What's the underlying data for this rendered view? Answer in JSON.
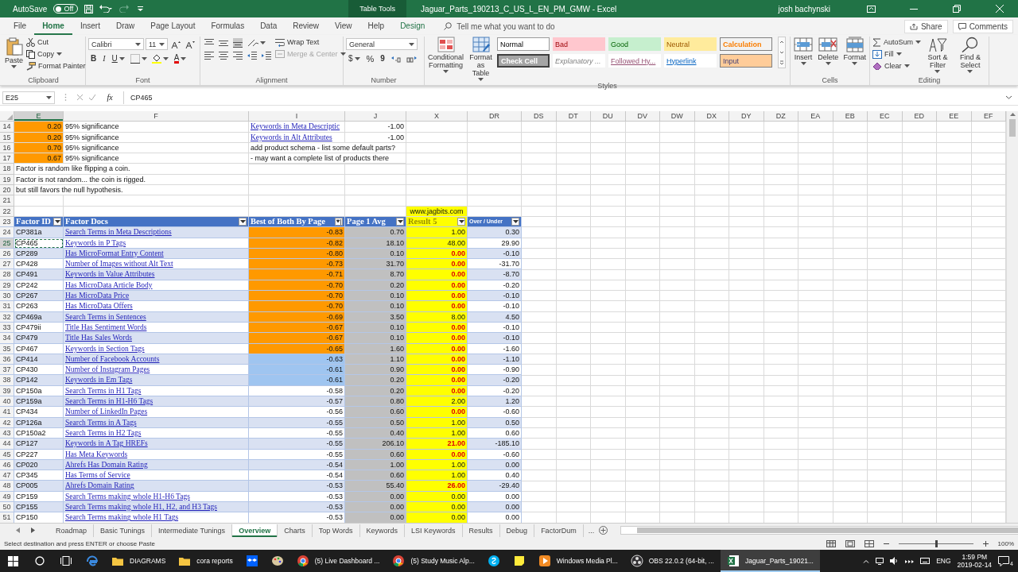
{
  "title_bar": {
    "autosave_label": "AutoSave",
    "autosave": {
      "label": "Off",
      "on": false
    },
    "context_tab": "Table Tools",
    "title": "Jaguar_Parts_190213_C_US_L_EN_PM_GMW  -  Excel",
    "user": "josh bachynski"
  },
  "menu": {
    "tabs": [
      {
        "label": "File",
        "kind": "standard",
        "selected": false
      },
      {
        "label": "Home",
        "kind": "standard",
        "selected": true
      },
      {
        "label": "Insert",
        "kind": "standard",
        "selected": false
      },
      {
        "label": "Draw",
        "kind": "standard",
        "selected": false
      },
      {
        "label": "Page Layout",
        "kind": "standard",
        "selected": false
      },
      {
        "label": "Formulas",
        "kind": "standard",
        "selected": false
      },
      {
        "label": "Data",
        "kind": "standard",
        "selected": false
      },
      {
        "label": "Review",
        "kind": "standard",
        "selected": false
      },
      {
        "label": "View",
        "kind": "standard",
        "selected": false
      },
      {
        "label": "Help",
        "kind": "standard",
        "selected": false
      },
      {
        "label": "Design",
        "kind": "contextual",
        "selected": false
      }
    ],
    "search_placeholder": "Tell me what you want to do",
    "share": "Share",
    "comments": "Comments"
  },
  "ribbon": [
    {
      "name": "Clipboard",
      "columns": [
        [
          [
            {
              "kind": "paste",
              "label": "Paste"
            }
          ]
        ],
        [
          [
            {
              "kind": "cut",
              "label": "Cut"
            }
          ],
          [
            {
              "kind": "copy",
              "label": "Copy"
            }
          ],
          [
            {
              "kind": "painter",
              "label": "Format Painter"
            }
          ]
        ]
      ]
    },
    {
      "name": "Font",
      "columns": [
        [
          [
            {
              "kind": "fontname",
              "label": "Calibri"
            },
            {
              "kind": "fontsize",
              "label": "11"
            },
            {
              "kind": "grow"
            },
            {
              "kind": "shrink"
            }
          ],
          [
            {
              "kind": "bold",
              "label": "B"
            },
            {
              "kind": "italic",
              "label": "I"
            },
            {
              "kind": "underline",
              "label": "U"
            },
            {
              "kind": "borders"
            },
            {
              "kind": "fillcolor"
            },
            {
              "kind": "fontcolor",
              "label": "A"
            }
          ]
        ]
      ]
    },
    {
      "name": "Alignment",
      "columns": [
        [
          [
            {
              "kind": "aligntop"
            },
            {
              "kind": "alignmiddle"
            },
            {
              "kind": "alignbottom"
            },
            {
              "kind": "orient"
            }
          ],
          [
            {
              "kind": "alignleft"
            },
            {
              "kind": "aligncenter"
            },
            {
              "kind": "alignright"
            },
            {
              "kind": "indentdec"
            },
            {
              "kind": "indentinc"
            }
          ]
        ],
        [
          [
            {
              "kind": "wrap",
              "label": "Wrap Text",
              "disabled": false
            }
          ],
          [
            {
              "kind": "merge",
              "label": "Merge & Center",
              "disabled": true
            }
          ]
        ]
      ]
    },
    {
      "name": "Number",
      "columns": [
        [
          [
            {
              "kind": "numformat",
              "label": "General"
            }
          ],
          [
            {
              "kind": "currency",
              "label": "$"
            },
            {
              "kind": "percent",
              "label": "%"
            },
            {
              "kind": "comma",
              "label": "9"
            },
            {
              "kind": "incdec"
            },
            {
              "kind": "decdec"
            }
          ]
        ]
      ]
    },
    {
      "name": "Styles",
      "columns": [
        [
          [
            {
              "kind": "cond",
              "label": "Conditional Formatting"
            }
          ]
        ],
        [
          [
            {
              "kind": "table",
              "label": "Format as Table"
            }
          ]
        ],
        [
          [
            {
              "kind": "normal",
              "label": "Normal"
            },
            {
              "kind": "bad",
              "label": "Bad"
            },
            {
              "kind": "good",
              "label": "Good"
            },
            {
              "kind": "neutral",
              "label": "Neutral"
            },
            {
              "kind": "calculation",
              "label": "Calculation"
            }
          ],
          [
            {
              "kind": "check",
              "label": "Check Cell"
            },
            {
              "kind": "explanatory",
              "label": "Explanatory ..."
            },
            {
              "kind": "followed",
              "label": "Followed Hy..."
            },
            {
              "kind": "hyperlink",
              "label": "Hyperlink"
            },
            {
              "kind": "input",
              "label": "Input"
            }
          ]
        ],
        [
          [
            {
              "kind": "more"
            }
          ]
        ]
      ]
    },
    {
      "name": "Cells",
      "columns": [
        [
          [
            {
              "kind": "insert",
              "label": "Insert"
            }
          ]
        ],
        [
          [
            {
              "kind": "delete",
              "label": "Delete"
            }
          ]
        ],
        [
          [
            {
              "kind": "format",
              "label": "Format"
            }
          ]
        ]
      ]
    },
    {
      "name": "Editing",
      "columns": [
        [
          [
            {
              "kind": "autosum",
              "label": "AutoSum"
            }
          ],
          [
            {
              "kind": "fill",
              "label": "Fill"
            }
          ],
          [
            {
              "kind": "clear",
              "label": "Clear"
            }
          ]
        ],
        [
          [
            {
              "kind": "sort",
              "label": "Sort & Filter"
            }
          ]
        ],
        [
          [
            {
              "kind": "find",
              "label": "Find & Select"
            }
          ]
        ]
      ]
    }
  ],
  "formula_bar": {
    "name_box": "E25",
    "function_label": "fx",
    "formula": "CP465"
  },
  "columns": [
    {
      "label": "E",
      "selected": true
    },
    {
      "label": "F",
      "selected": false
    },
    {
      "label": "I",
      "selected": false
    },
    {
      "label": "J",
      "selected": false
    },
    {
      "label": "X",
      "selected": false
    },
    {
      "label": "DR",
      "selected": false
    },
    {
      "label": "DS",
      "selected": false
    },
    {
      "label": "DT",
      "selected": false
    },
    {
      "label": "DU",
      "selected": false
    },
    {
      "label": "DV",
      "selected": false
    },
    {
      "label": "DW",
      "selected": false
    },
    {
      "label": "DX",
      "selected": false
    },
    {
      "label": "DY",
      "selected": false
    },
    {
      "label": "DZ",
      "selected": false
    },
    {
      "label": "EA",
      "selected": false
    },
    {
      "label": "EB",
      "selected": false
    },
    {
      "label": "EC",
      "selected": false
    },
    {
      "label": "ED",
      "selected": false
    },
    {
      "label": "EE",
      "selected": false
    },
    {
      "label": "EF",
      "selected": false
    }
  ],
  "notes_rows": [
    {
      "num": "14",
      "selected": false,
      "e": {
        "kind": "highlight",
        "text": "0.20"
      },
      "f": {
        "kind": "text",
        "text": "95% significance"
      },
      "i": {
        "kind": "link",
        "text": "Keywords in Meta Descriptic"
      },
      "j": {
        "kind": "number",
        "text": "-1.00"
      }
    },
    {
      "num": "15",
      "selected": false,
      "e": {
        "kind": "highlight",
        "text": "0.20"
      },
      "f": {
        "kind": "text",
        "text": "95% significance"
      },
      "i": {
        "kind": "link",
        "text": "Keywords in Alt Attributes"
      },
      "j": {
        "kind": "number",
        "text": "-1.00"
      }
    },
    {
      "num": "16",
      "selected": false,
      "e": {
        "kind": "highlight",
        "text": "0.70"
      },
      "f": {
        "kind": "text",
        "text": "95% significance"
      },
      "i": {
        "kind": "text",
        "text": "add product schema - list some default parts?"
      }
    },
    {
      "num": "17",
      "selected": false,
      "e": {
        "kind": "highlight",
        "text": "0.67"
      },
      "f": {
        "kind": "text",
        "text": "95% significance"
      },
      "i": {
        "kind": "text",
        "text": "- may want a complete list of products there"
      }
    },
    {
      "num": "18",
      "selected": false,
      "e": {
        "kind": "text",
        "text": "Factor is random like flipping a coin."
      }
    },
    {
      "num": "19",
      "selected": false,
      "e": {
        "kind": "text",
        "text": "Factor is not random... the coin is rigged."
      }
    },
    {
      "num": "20",
      "selected": false,
      "e": {
        "kind": "text",
        "text": "but still favors the null hypothesis."
      }
    },
    {
      "num": "21",
      "selected": false
    },
    {
      "num": "22",
      "selected": false,
      "x": {
        "kind": "banner",
        "text": "www.jagbits.com"
      }
    }
  ],
  "table": {
    "header_num": "23",
    "header_selected": false,
    "columns": [
      {
        "label": "Factor ID",
        "sorted": false
      },
      {
        "label": "Factor Docs",
        "sorted": false
      },
      {
        "label": "Best of Both By Page",
        "sorted": true
      },
      {
        "label": "Page 1 Avg",
        "sorted": false
      },
      {
        "label": "Result 5",
        "sorted": false
      },
      {
        "label": "Over / Under",
        "sorted": false
      }
    ],
    "rows": [
      {
        "num": "24",
        "id": "CP381a",
        "doc": "Search Terms in Meta Descriptions",
        "best": "-0.83",
        "avg": "0.70",
        "result": "1.00",
        "over_under": "0.30",
        "color": "#ff9900",
        "flagged": false,
        "selected": false
      },
      {
        "num": "25",
        "id": "CP465",
        "doc": "Keywords in P Tags",
        "best": "-0.82",
        "avg": "18.10",
        "result": "48.00",
        "over_under": "29.90",
        "color": "#ff9900",
        "flagged": false,
        "selected": true
      },
      {
        "num": "26",
        "id": "CP289",
        "doc": "Has MicroFormat Entry Content",
        "best": "-0.80",
        "avg": "0.10",
        "result": "0.00",
        "over_under": "-0.10",
        "color": "#ff9900",
        "flagged": true,
        "selected": false
      },
      {
        "num": "27",
        "id": "CP428",
        "doc": "Number of Images without Alt Text",
        "best": "-0.73",
        "avg": "31.70",
        "result": "0.00",
        "over_under": "-31.70",
        "color": "#ff9900",
        "flagged": true,
        "selected": false
      },
      {
        "num": "28",
        "id": "CP491",
        "doc": "Keywords in Value Attributes",
        "best": "-0.71",
        "avg": "8.70",
        "result": "0.00",
        "over_under": "-8.70",
        "color": "#ff9900",
        "flagged": true,
        "selected": false
      },
      {
        "num": "29",
        "id": "CP242",
        "doc": "Has MicroData Article Body",
        "best": "-0.70",
        "avg": "0.20",
        "result": "0.00",
        "over_under": "-0.20",
        "color": "#ff9900",
        "flagged": true,
        "selected": false
      },
      {
        "num": "30",
        "id": "CP267",
        "doc": "Has MicroData Price",
        "best": "-0.70",
        "avg": "0.10",
        "result": "0.00",
        "over_under": "-0.10",
        "color": "#ff9900",
        "flagged": true,
        "selected": false
      },
      {
        "num": "31",
        "id": "CP263",
        "doc": "Has MicroData Offers",
        "best": "-0.70",
        "avg": "0.10",
        "result": "0.00",
        "over_under": "-0.10",
        "color": "#ff9900",
        "flagged": true,
        "selected": false
      },
      {
        "num": "32",
        "id": "CP469a",
        "doc": "Search Terms in Sentences",
        "best": "-0.69",
        "avg": "3.50",
        "result": "8.00",
        "over_under": "4.50",
        "color": "#ff9900",
        "flagged": false,
        "selected": false
      },
      {
        "num": "33",
        "id": "CP479ii",
        "doc": "Title Has Sentiment Words",
        "best": "-0.67",
        "avg": "0.10",
        "result": "0.00",
        "over_under": "-0.10",
        "color": "#ff9900",
        "flagged": true,
        "selected": false
      },
      {
        "num": "34",
        "id": "CP479",
        "doc": "Title Has Sales Words",
        "best": "-0.67",
        "avg": "0.10",
        "result": "0.00",
        "over_under": "-0.10",
        "color": "#ff9900",
        "flagged": true,
        "selected": false
      },
      {
        "num": "35",
        "id": "CP467",
        "doc": "Keywords in Section Tags",
        "best": "-0.65",
        "avg": "1.60",
        "result": "0.00",
        "over_under": "-1.60",
        "color": "#ff9900",
        "flagged": true,
        "selected": false
      },
      {
        "num": "36",
        "id": "CP414",
        "doc": "Number of Facebook Accounts",
        "best": "-0.63",
        "avg": "1.10",
        "result": "0.00",
        "over_under": "-1.10",
        "color": "#9fc5f0",
        "flagged": true,
        "selected": false
      },
      {
        "num": "37",
        "id": "CP430",
        "doc": "Number of Instagram Pages",
        "best": "-0.61",
        "avg": "0.90",
        "result": "0.00",
        "over_under": "-0.90",
        "color": "#9fc5f0",
        "flagged": true,
        "selected": false
      },
      {
        "num": "38",
        "id": "CP142",
        "doc": "Keywords in Em Tags",
        "best": "-0.61",
        "avg": "0.20",
        "result": "0.00",
        "over_under": "-0.20",
        "color": "#9fc5f0",
        "flagged": true,
        "selected": false
      },
      {
        "num": "39",
        "id": "CP150a",
        "doc": "Search Terms in H1 Tags",
        "best": "-0.58",
        "avg": "0.20",
        "result": "0.00",
        "over_under": "-0.20",
        "flagged": true,
        "selected": false
      },
      {
        "num": "40",
        "id": "CP159a",
        "doc": "Search Terms in H1-H6 Tags",
        "best": "-0.57",
        "avg": "0.80",
        "result": "2.00",
        "over_under": "1.20",
        "flagged": false,
        "selected": false
      },
      {
        "num": "41",
        "id": "CP434",
        "doc": "Number of LinkedIn Pages",
        "best": "-0.56",
        "avg": "0.60",
        "result": "0.00",
        "over_under": "-0.60",
        "flagged": true,
        "selected": false
      },
      {
        "num": "42",
        "id": "CP126a",
        "doc": "Search Terms in A Tags",
        "best": "-0.55",
        "avg": "0.50",
        "result": "1.00",
        "over_under": "0.50",
        "flagged": false,
        "selected": false
      },
      {
        "num": "43",
        "id": "CP150a2",
        "doc": "Search Terms in H2 Tags",
        "best": "-0.55",
        "avg": "0.40",
        "result": "1.00",
        "over_under": "0.60",
        "flagged": false,
        "selected": false
      },
      {
        "num": "44",
        "id": "CP127",
        "doc": "Keywords in A Tag HREFs",
        "best": "-0.55",
        "avg": "206.10",
        "result": "21.00",
        "over_under": "-185.10",
        "flagged": true,
        "selected": false
      },
      {
        "num": "45",
        "id": "CP227",
        "doc": "Has Meta Keywords",
        "best": "-0.55",
        "avg": "0.60",
        "result": "0.00",
        "over_under": "-0.60",
        "flagged": true,
        "selected": false
      },
      {
        "num": "46",
        "id": "CP020",
        "doc": "Ahrefs Has Domain Rating",
        "best": "-0.54",
        "avg": "1.00",
        "result": "1.00",
        "over_under": "0.00",
        "flagged": false,
        "selected": false
      },
      {
        "num": "47",
        "id": "CP345",
        "doc": "Has Terms of Service",
        "best": "-0.54",
        "avg": "0.60",
        "result": "1.00",
        "over_under": "0.40",
        "flagged": false,
        "selected": false
      },
      {
        "num": "48",
        "id": "CP005",
        "doc": "Ahrefs Domain Rating",
        "best": "-0.53",
        "avg": "55.40",
        "result": "26.00",
        "over_under": "-29.40",
        "flagged": true,
        "selected": false
      },
      {
        "num": "49",
        "id": "CP159",
        "doc": "Search Terms making whole H1-H6 Tags",
        "best": "-0.53",
        "avg": "0.00",
        "result": "0.00",
        "over_under": "0.00",
        "flagged": false,
        "selected": false
      },
      {
        "num": "50",
        "id": "CP155",
        "doc": "Search Terms making whole H1, H2, and H3 Tags",
        "best": "-0.53",
        "avg": "0.00",
        "result": "0.00",
        "over_under": "0.00",
        "flagged": false,
        "selected": false
      },
      {
        "num": "51",
        "id": "CP150",
        "doc": "Search Terms making whole H1 Tags",
        "best": "-0.53",
        "avg": "0.00",
        "result": "0.00",
        "over_under": "0.00",
        "flagged": false,
        "selected": false
      }
    ]
  },
  "sheet_tabs": {
    "tabs": [
      {
        "label": "Roadmap",
        "selected": false
      },
      {
        "label": "Basic Tunings",
        "selected": false
      },
      {
        "label": "Intermediate Tunings",
        "selected": false
      },
      {
        "label": "Overview",
        "selected": true
      },
      {
        "label": "Charts",
        "selected": false
      },
      {
        "label": "Top Words",
        "selected": false
      },
      {
        "label": "Keywords",
        "selected": false
      },
      {
        "label": "LSI Keywords",
        "selected": false
      },
      {
        "label": "Results",
        "selected": false
      },
      {
        "label": "Debug",
        "selected": false
      },
      {
        "label": "FactorDum",
        "selected": false
      }
    ],
    "more": "..."
  },
  "status_bar": {
    "message": "Select destination and press ENTER or choose Paste",
    "zoom": {
      "label": "100%",
      "level": 0.5
    }
  },
  "taskbar": {
    "items": [
      {
        "kind": "folder",
        "label": "DIAGRAMS",
        "selected": false
      },
      {
        "kind": "folder",
        "label": "cora reports",
        "selected": false
      },
      {
        "kind": "dropbox",
        "selected": false
      },
      {
        "kind": "paint",
        "selected": false
      },
      {
        "kind": "chrome",
        "label": "(5) Live Dashboard ...",
        "selected": false
      },
      {
        "kind": "chrome",
        "label": "(5) Study Music Alp...",
        "selected": false
      },
      {
        "kind": "skype",
        "selected": false
      },
      {
        "kind": "notes",
        "selected": false
      },
      {
        "kind": "media",
        "label": "Windows Media Pl...",
        "selected": false
      },
      {
        "kind": "obs",
        "label": "OBS 22.0.2 (64-bit, ...",
        "selected": false
      },
      {
        "kind": "excel",
        "label": "Jaguar_Parts_19021...",
        "selected": true
      }
    ],
    "language": "ENG",
    "time": "1:59 PM",
    "date": "2019-02-14",
    "notifications": "4"
  }
}
